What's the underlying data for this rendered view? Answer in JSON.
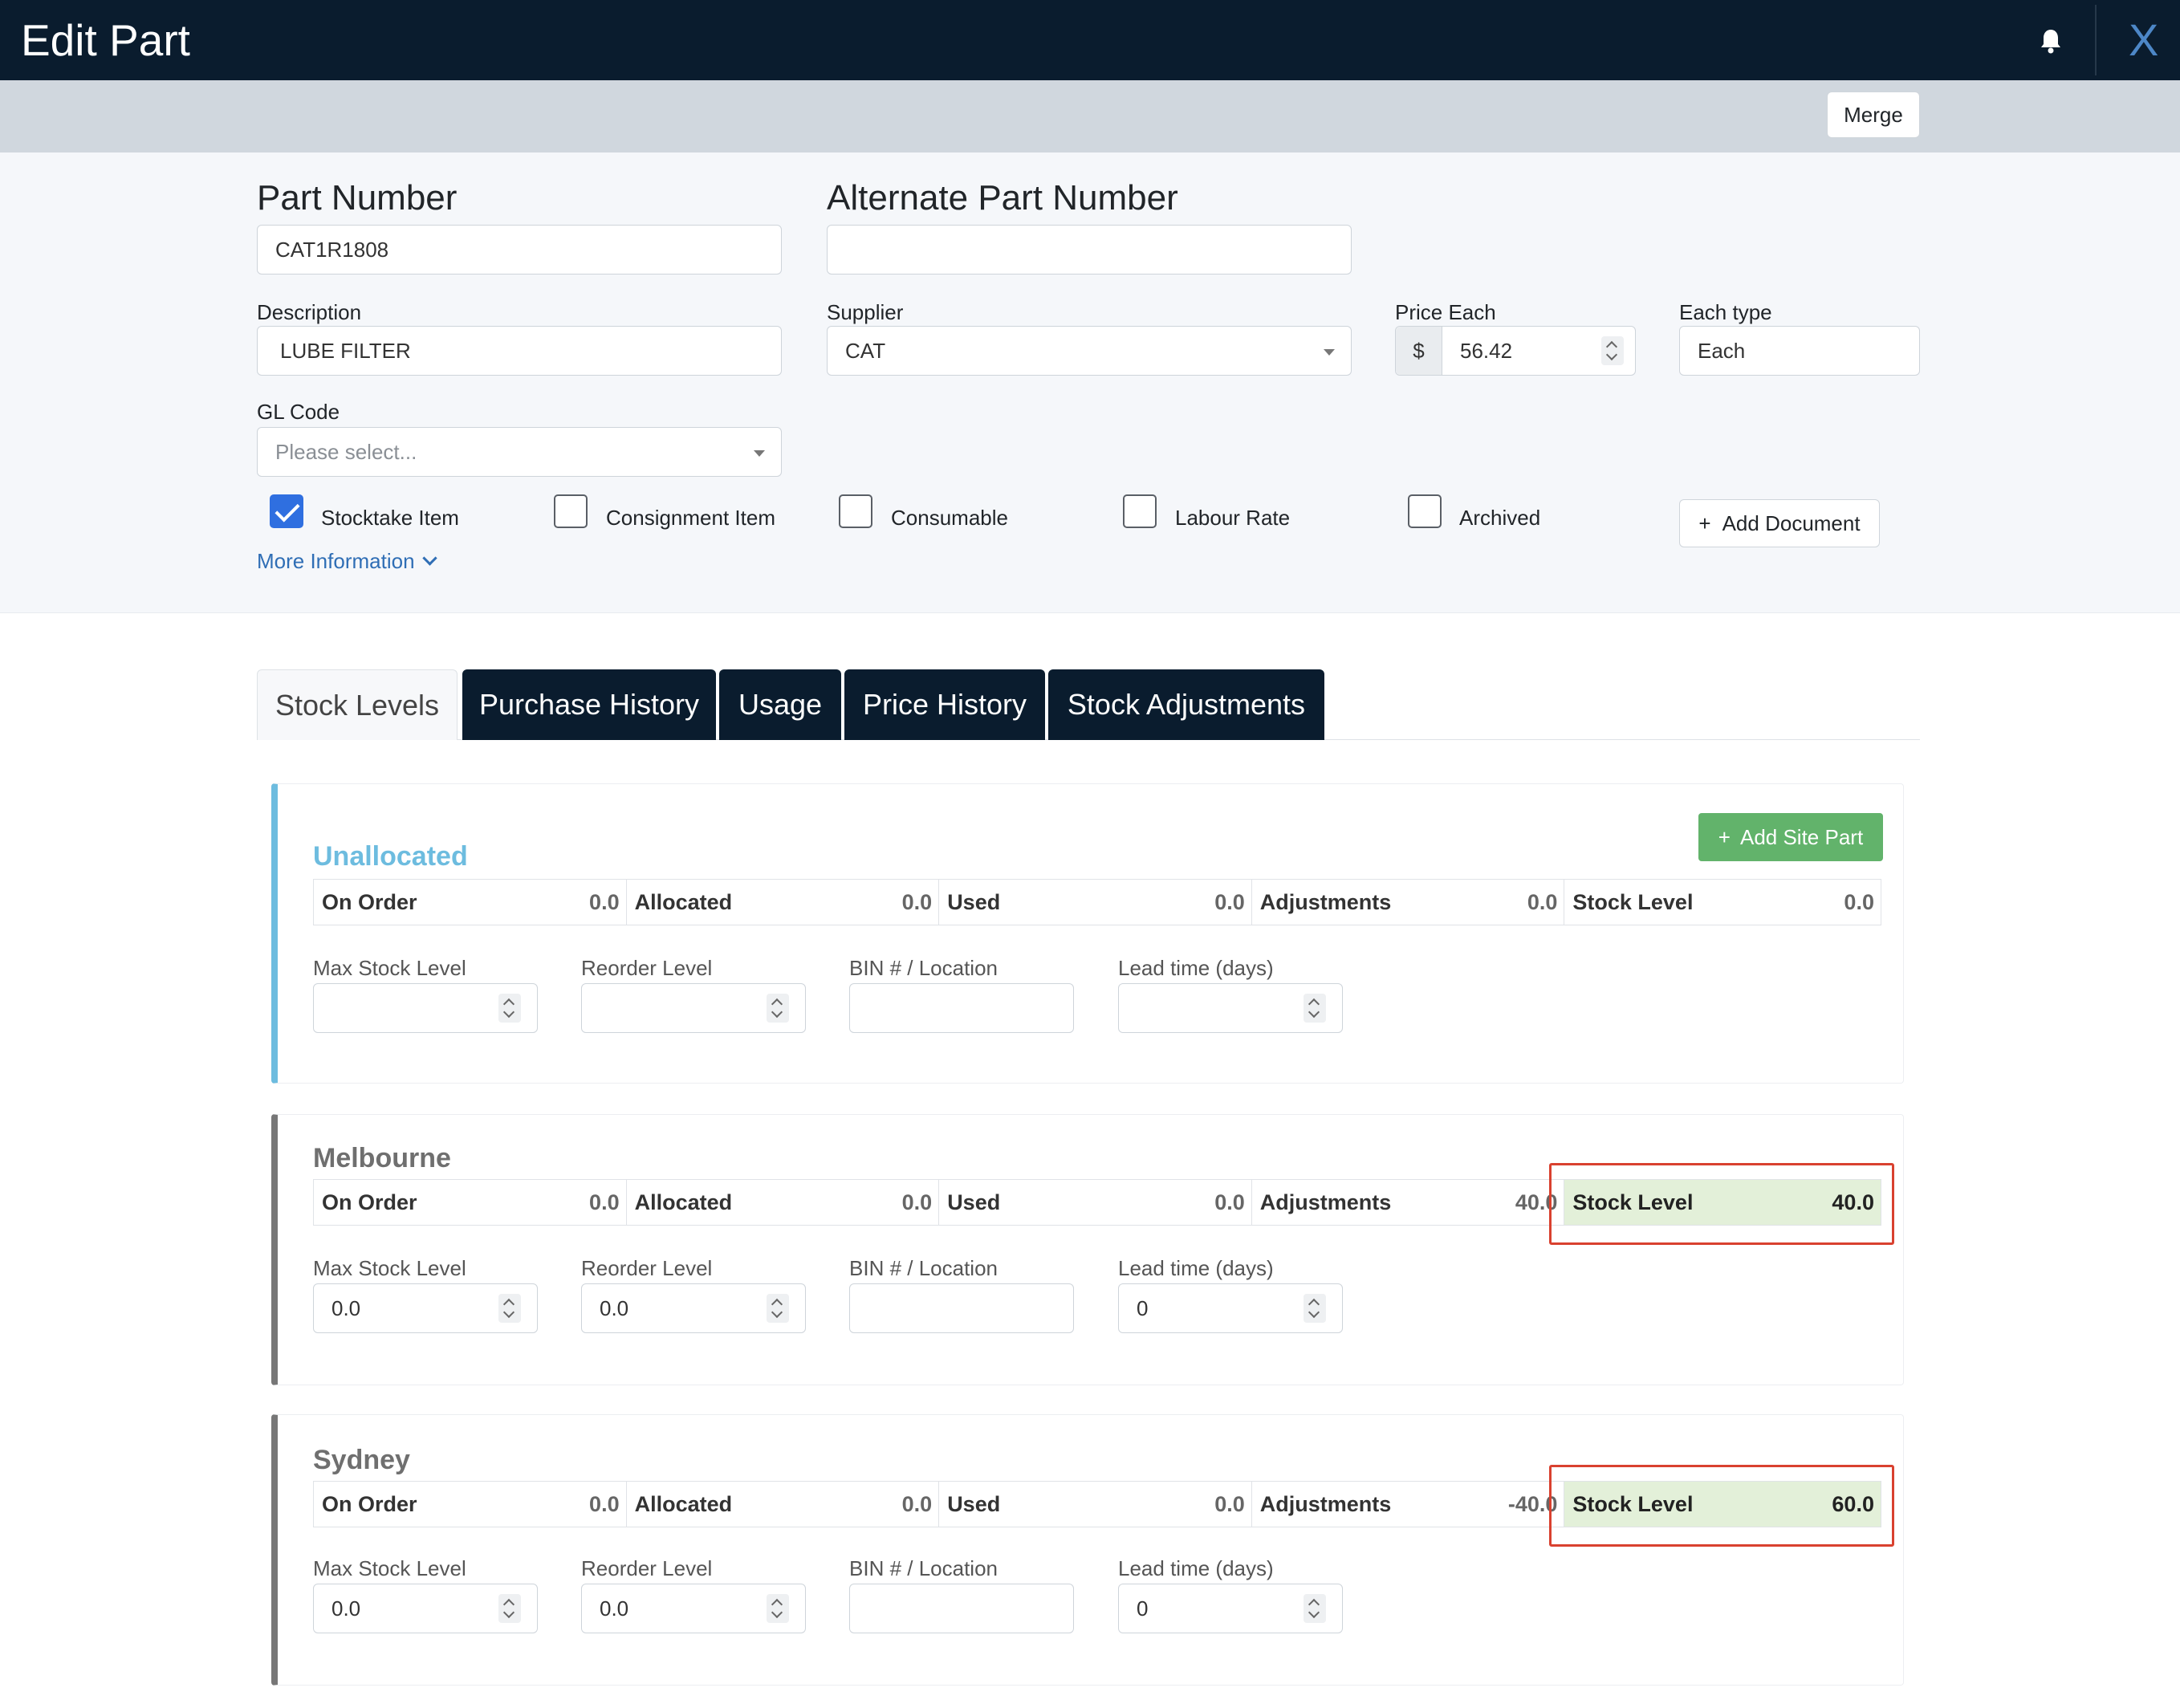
{
  "header": {
    "title": "Edit Part",
    "close_label": "X",
    "bell_icon": "bell-icon"
  },
  "toolbar": {
    "merge_label": "Merge"
  },
  "form": {
    "part_number_label": "Part Number",
    "part_number_value": "CAT1R1808",
    "alt_part_number_label": "Alternate Part Number",
    "alt_part_number_value": "",
    "description_label": "Description",
    "description_value": "LUBE FILTER",
    "supplier_label": "Supplier",
    "supplier_value": "CAT",
    "price_label": "Price Each",
    "price_currency": "$",
    "price_value": "56.42",
    "each_type_label": "Each type",
    "each_type_value": "Each",
    "gl_code_label": "GL Code",
    "gl_code_placeholder": "Please select...",
    "checkboxes": [
      {
        "label": "Stocktake Item",
        "checked": true
      },
      {
        "label": "Consignment Item",
        "checked": false
      },
      {
        "label": "Consumable",
        "checked": false
      },
      {
        "label": "Labour Rate",
        "checked": false
      },
      {
        "label": "Archived",
        "checked": false
      }
    ],
    "add_document_label": "Add Document",
    "more_info_label": "More Information"
  },
  "tabs": [
    {
      "label": "Stock Levels",
      "active": true
    },
    {
      "label": "Purchase History",
      "active": false
    },
    {
      "label": "Usage",
      "active": false
    },
    {
      "label": "Price History",
      "active": false
    },
    {
      "label": "Stock Adjustments",
      "active": false
    }
  ],
  "add_site_part_label": "Add Site Part",
  "field_labels": {
    "max_stock": "Max Stock Level",
    "reorder": "Reorder Level",
    "bin": "BIN # / Location",
    "lead_time": "Lead time (days)"
  },
  "stat_labels": {
    "on_order": "On Order",
    "allocated": "Allocated",
    "used": "Used",
    "adjustments": "Adjustments",
    "stock_level": "Stock Level"
  },
  "sites": [
    {
      "name": "Unallocated",
      "on_order": "0.0",
      "allocated": "0.0",
      "used": "0.0",
      "adjustments": "0.0",
      "stock_level": "0.0",
      "max_stock": "",
      "reorder": "",
      "bin": "",
      "lead_time": ""
    },
    {
      "name": "Melbourne",
      "on_order": "0.0",
      "allocated": "0.0",
      "used": "0.0",
      "adjustments": "40.0",
      "stock_level": "40.0",
      "max_stock": "0.0",
      "reorder": "0.0",
      "bin": "",
      "lead_time": "0"
    },
    {
      "name": "Sydney",
      "on_order": "0.0",
      "allocated": "0.0",
      "used": "0.0",
      "adjustments": "-40.0",
      "stock_level": "60.0",
      "max_stock": "0.0",
      "reorder": "0.0",
      "bin": "",
      "lead_time": "0"
    }
  ],
  "colors": {
    "header_bg": "#0a1c2e",
    "accent_blue": "#2f6fe0",
    "unallocated": "#6dbcdf",
    "success": "#62b36b",
    "highlight_red": "#d9412f"
  }
}
